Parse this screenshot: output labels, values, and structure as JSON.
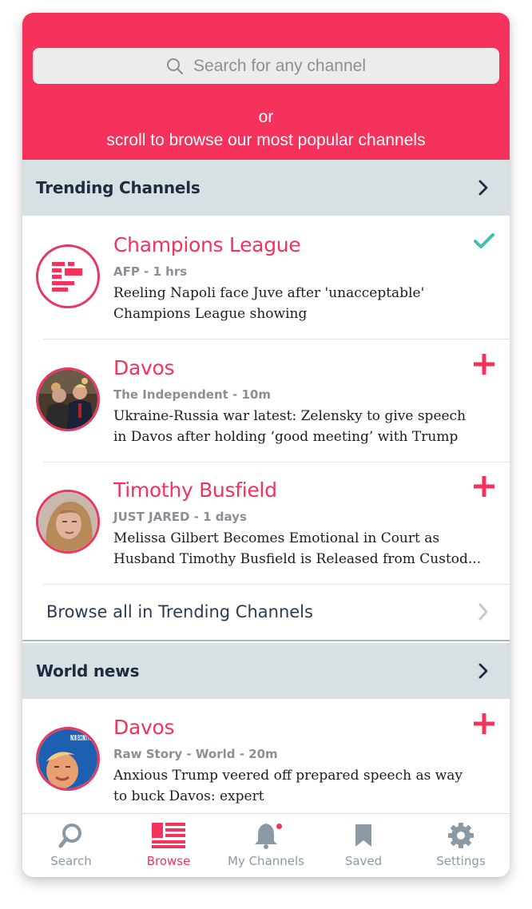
{
  "search": {
    "placeholder": "Search for any channel"
  },
  "header": {
    "line1": "or",
    "line2": "scroll to browse our most popular channels"
  },
  "sections": [
    {
      "title": "Trending Channels",
      "browse_all": "Browse all in Trending Channels"
    },
    {
      "title": "World news"
    }
  ],
  "trending_items": [
    {
      "title": "Champions League",
      "source": "AFP - 1 hrs",
      "headline1": "Reeling Napoli face Juve after 'unacceptable'",
      "headline2": "Champions League showing",
      "action": "check-icon"
    },
    {
      "title": "Davos",
      "source": "The Independent - 10m",
      "headline1": "Ukraine-Russia war latest: Zelensky to give speech",
      "headline2": "in Davos after holding ‘good meeting’ with Trump",
      "action": "plus-icon"
    },
    {
      "title": "Timothy Busfield",
      "source": "JUST JARED - 1 days",
      "headline1": "Melissa Gilbert Becomes Emotional in Court as",
      "headline2": "Husband Timothy Busfield is Released from Custod...",
      "action": "plus-icon"
    }
  ],
  "world_items": [
    {
      "title": "Davos",
      "source": "Raw Story - World - 20m",
      "headline1": "Anxious Trump veered off prepared speech as way",
      "headline2": "to buck Davos: expert",
      "action": "plus-icon",
      "avatar_text": "WOR ECONO FORUM"
    }
  ],
  "tabs": [
    {
      "label": "Search",
      "icon": "search-icon"
    },
    {
      "label": "Browse",
      "icon": "browse-icon",
      "active": true
    },
    {
      "label": "My Channels",
      "icon": "bell-icon"
    },
    {
      "label": "Saved",
      "icon": "bookmark-icon"
    },
    {
      "label": "Settings",
      "icon": "gear-icon"
    }
  ],
  "colors": {
    "accent": "#f5325c",
    "section_bg": "#d7e0e2",
    "check": "#3fbfb0",
    "tab_inactive": "#8b99a4"
  }
}
